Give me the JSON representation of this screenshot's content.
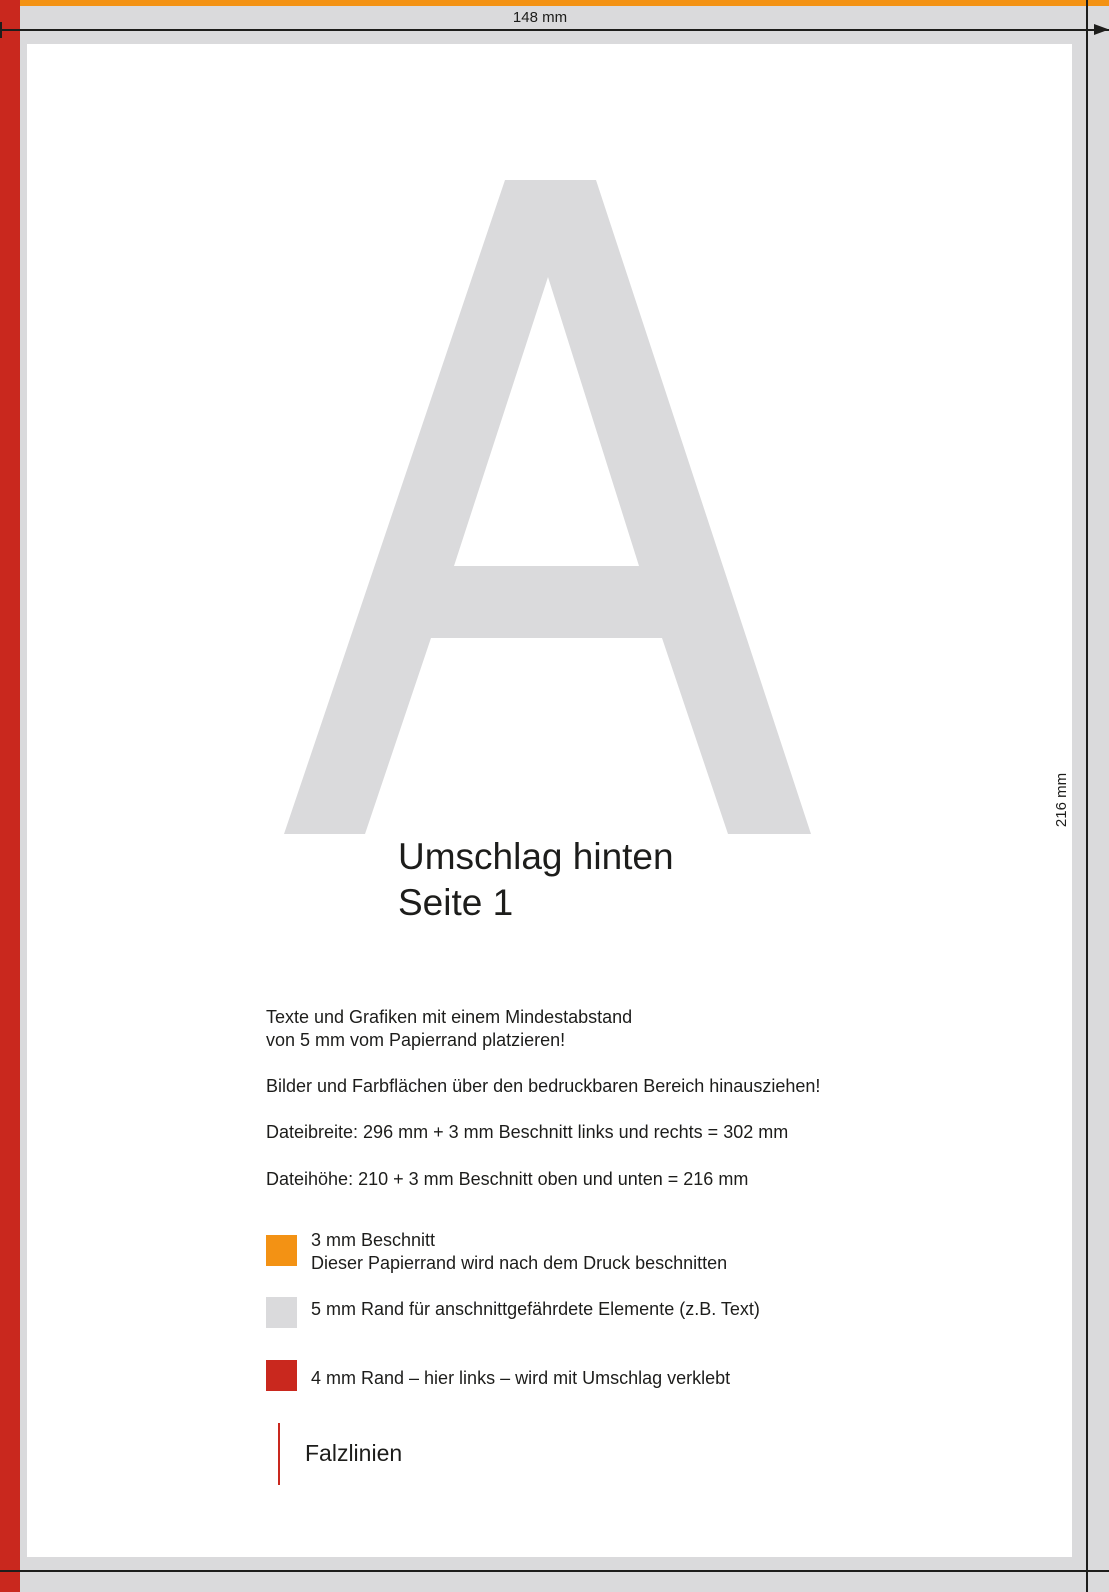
{
  "dimensions": {
    "width_label": "148 mm",
    "height_label": "216 mm"
  },
  "placeholder_glyph": "A",
  "title": {
    "line1": "Umschlag hinten",
    "line2": "Seite 1"
  },
  "instructions": {
    "placement_line1": "Texte und Grafiken mit einem Mindestabstand",
    "placement_line2": "von 5 mm vom Papierrand platzieren!",
    "images": "Bilder und Farbflächen über den bedruckbaren Bereich hinausziehen!",
    "file_width": "Dateibreite: 296 mm + 3 mm Beschnitt links und rechts = 302 mm",
    "file_height": "Dateihöhe: 210 + 3 mm Beschnitt oben und unten = 216 mm"
  },
  "legend": {
    "bleed_line1": "3 mm Beschnitt",
    "bleed_line2": "Dieser Papierrand wird nach dem Druck beschnitten",
    "safe_margin": "5 mm Rand für anschnittgefährdete Elemente (z.B. Text)",
    "glue_margin": "4 mm Rand – hier links – wird mit Umschlag verklebt",
    "fold_lines": "Falzlinien"
  },
  "colors": {
    "bleed": "#f39214",
    "safe_margin": "#dadadc",
    "glue_margin": "#c9281e",
    "fold_line": "#c9281e",
    "placeholder_glyph": "#dadadc",
    "text": "#1d1d1b"
  }
}
